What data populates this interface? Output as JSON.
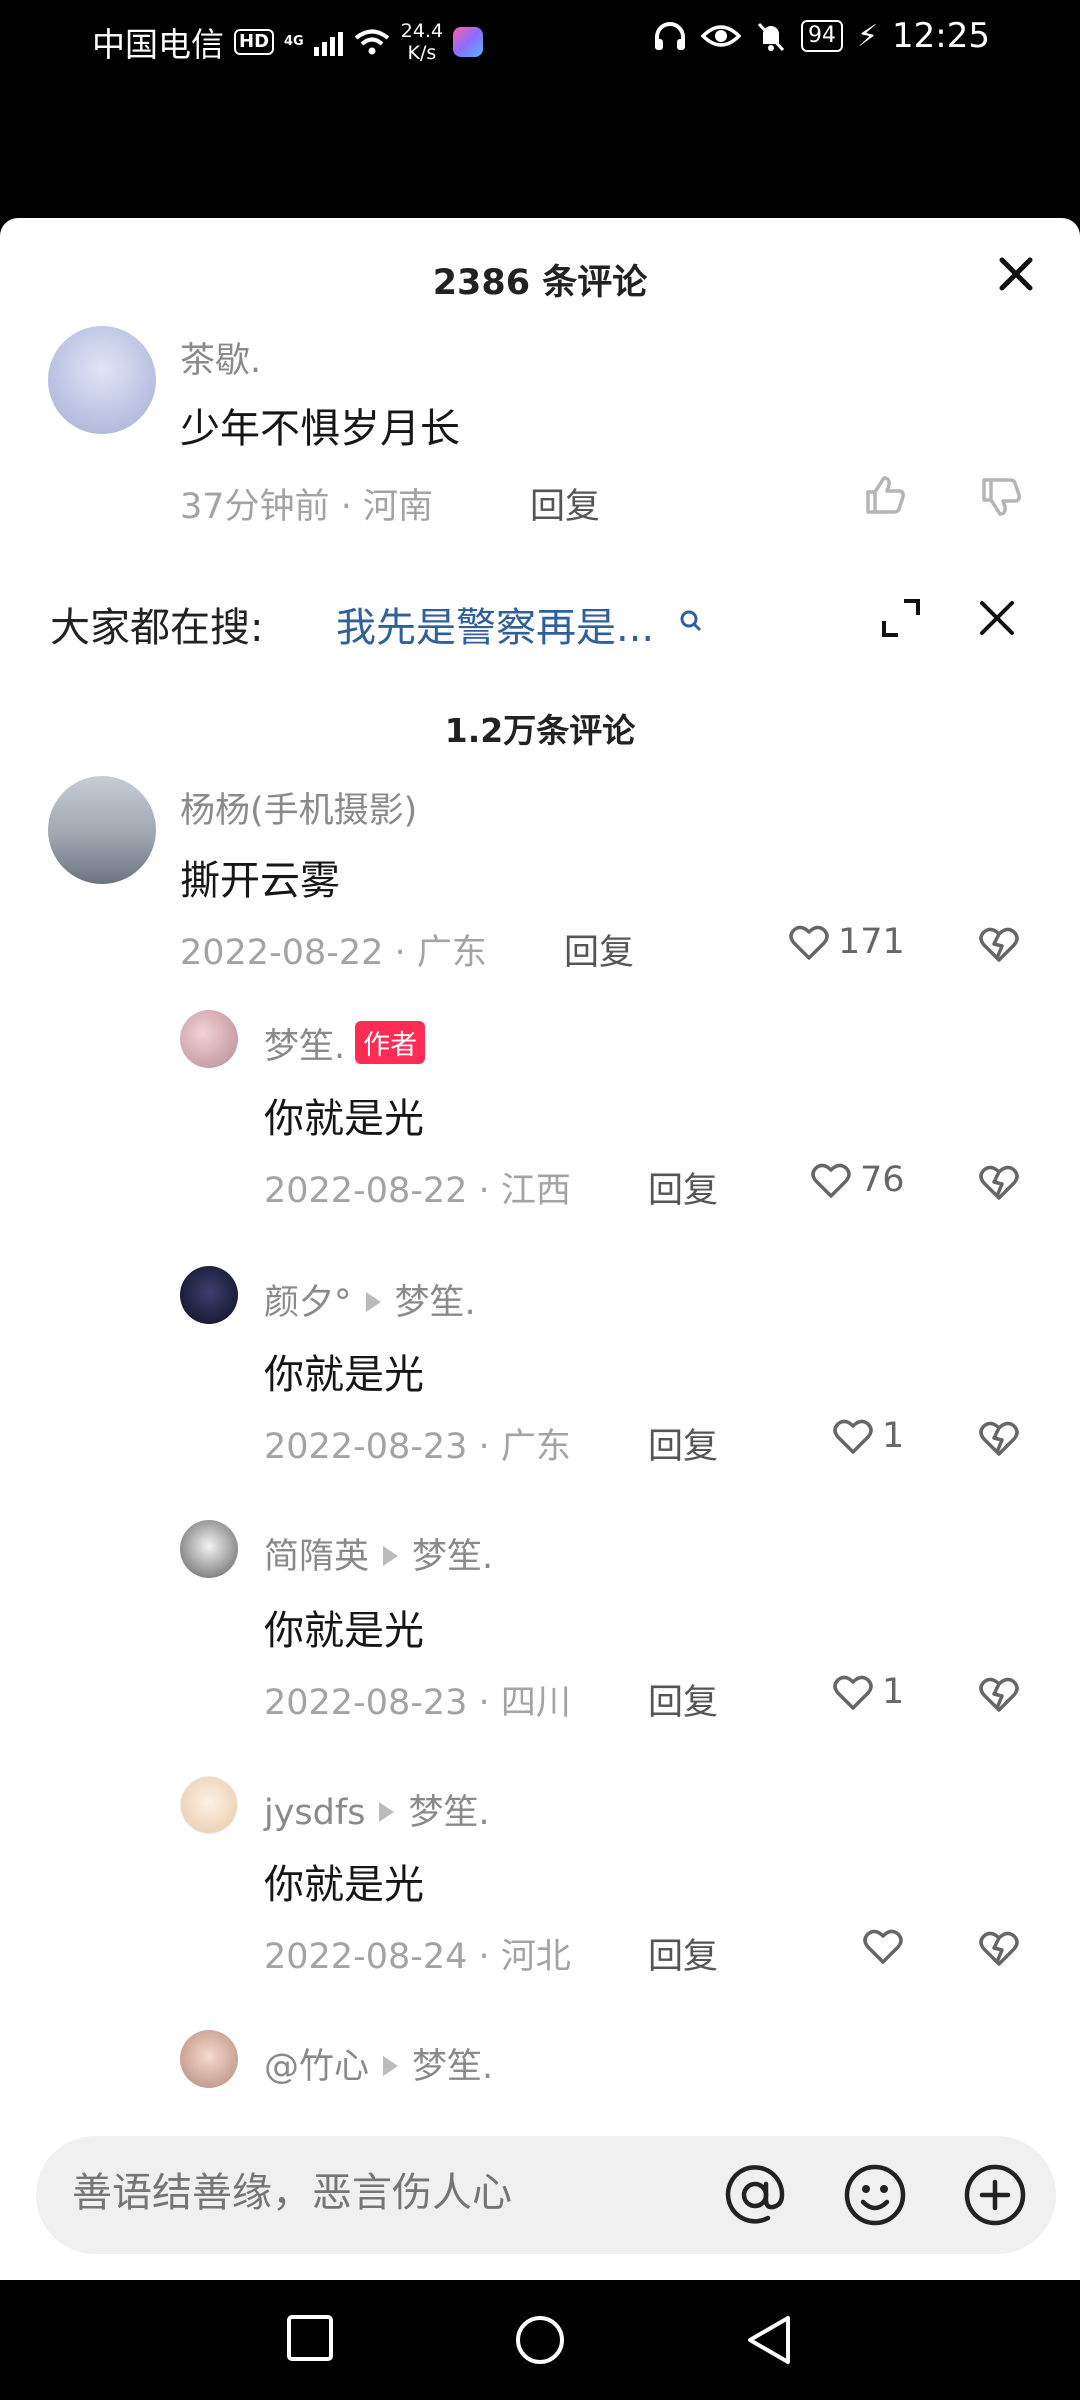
{
  "status_bar": {
    "carrier": "中国电信",
    "hd": "HD",
    "network": "4G",
    "speed_value": "24.4",
    "speed_unit": "K/s",
    "battery": "94",
    "time": "12:25"
  },
  "sheet": {
    "title": "2386 条评论",
    "top_comment": {
      "username": "茶歇.",
      "text": "少年不惧岁月长",
      "time": "37分钟前",
      "location": "河南",
      "reply_label": "回复"
    },
    "search_bar": {
      "label": "大家都在搜:",
      "query": "我先是警察再是..."
    },
    "comment_count": "1.2万条评论",
    "comments": [
      {
        "username": "杨杨(手机摄影)",
        "text": "撕开云雾",
        "date": "2022-08-22",
        "location": "广东",
        "reply_label": "回复",
        "likes": "171"
      },
      {
        "username": "梦笙.",
        "badge": "作者",
        "text": "你就是光",
        "date": "2022-08-22",
        "location": "江西",
        "reply_label": "回复",
        "likes": "76"
      },
      {
        "username": "颜夕°",
        "reply_to": "梦笙.",
        "text": "你就是光",
        "date": "2022-08-23",
        "location": "广东",
        "reply_label": "回复",
        "likes": "1"
      },
      {
        "username": "简隋英",
        "reply_to": "梦笙.",
        "text": "你就是光",
        "date": "2022-08-23",
        "location": "四川",
        "reply_label": "回复",
        "likes": "1"
      },
      {
        "username": "jysdfs",
        "reply_to": "梦笙.",
        "text": "你就是光",
        "date": "2022-08-24",
        "location": "河北",
        "reply_label": "回复",
        "likes": ""
      },
      {
        "username": "@竹心",
        "reply_to": "梦笙."
      }
    ]
  },
  "input_bar": {
    "placeholder": "善语结善缘，恶言伤人心"
  },
  "icons": {
    "close": "close-icon",
    "thumb_up": "thumb-up-icon",
    "thumb_down": "thumb-down-icon",
    "heart": "heart-icon",
    "broken_heart": "broken-heart-icon",
    "at": "at-icon",
    "emoji": "emoji-icon",
    "plus": "plus-icon"
  },
  "colors": {
    "accent_red": "#fe2c55",
    "link_blue": "#2f5f9c"
  }
}
